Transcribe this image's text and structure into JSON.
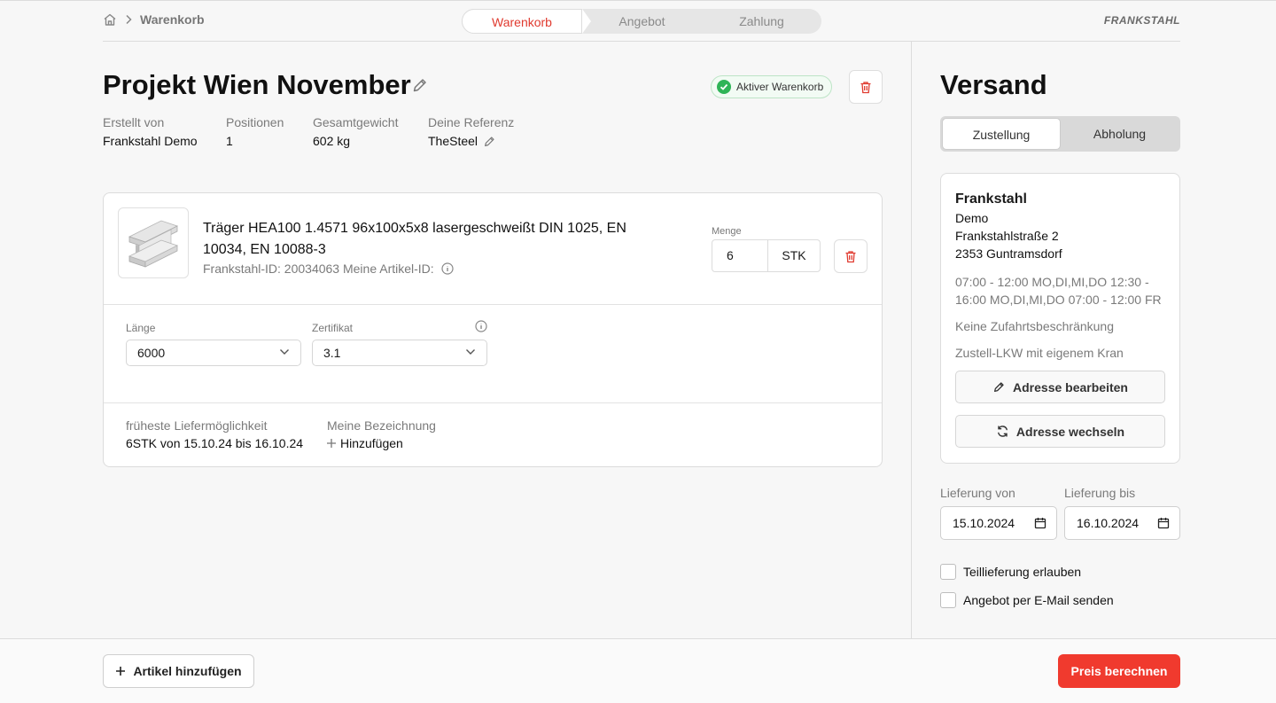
{
  "breadcrumb": {
    "current": "Warenkorb"
  },
  "steps": [
    "Warenkorb",
    "Angebot",
    "Zahlung"
  ],
  "logo": "FRANKSTAHL",
  "cart": {
    "title": "Projekt Wien November",
    "status_badge": "Aktiver Warenkorb",
    "meta": [
      {
        "label": "Erstellt von",
        "value": "Frankstahl Demo"
      },
      {
        "label": "Positionen",
        "value": "1"
      },
      {
        "label": "Gesamtgewicht",
        "value": "602 kg"
      },
      {
        "label": "Deine Referenz",
        "value": "TheSteel"
      }
    ]
  },
  "item": {
    "name": "Träger HEA100 1.4571 96x100x5x8 lasergeschweißt DIN 1025, EN 10034, EN 10088-3",
    "ids": "Frankstahl-ID: 20034063  Meine Artikel-ID:",
    "quantity_label": "Menge",
    "quantity": "6",
    "unit": "STK",
    "fields": {
      "length_label": "Länge",
      "length_value": "6000",
      "cert_label": "Zertifikat",
      "cert_value": "3.1"
    },
    "delivery_label": "früheste Liefermöglichkeit",
    "delivery_value": "6STK von 15.10.24 bis 16.10.24",
    "designation_label": "Meine Bezeichnung",
    "designation_add": "Hinzufügen"
  },
  "shipping": {
    "title": "Versand",
    "toggle": [
      "Zustellung",
      "Abholung"
    ],
    "address": {
      "company": "Frankstahl",
      "line1": "Demo",
      "street": "Frankstahlstraße 2",
      "city": "2353 Guntramsdorf",
      "hours": "07:00 - 12:00 MO,DI,MI,DO 12:30 - 16:00 MO,DI,MI,DO 07:00 - 12:00 FR",
      "access": "Keine Zufahrtsbeschränkung",
      "truck": "Zustell-LKW mit eigenem Kran",
      "edit_button": "Adresse bearbeiten",
      "change_button": "Adresse wechseln"
    },
    "from_label": "Lieferung von",
    "from_value": "15.10.2024",
    "to_label": "Lieferung bis",
    "to_value": "16.10.2024",
    "partial_delivery": "Teillieferung erlauben",
    "email_offer": "Angebot per E-Mail senden"
  },
  "footer": {
    "add_item": "Artikel hinzufügen",
    "calc_price": "Preis berechnen"
  },
  "colors": {
    "accent": "#f03a2e",
    "success": "#2fb457"
  }
}
